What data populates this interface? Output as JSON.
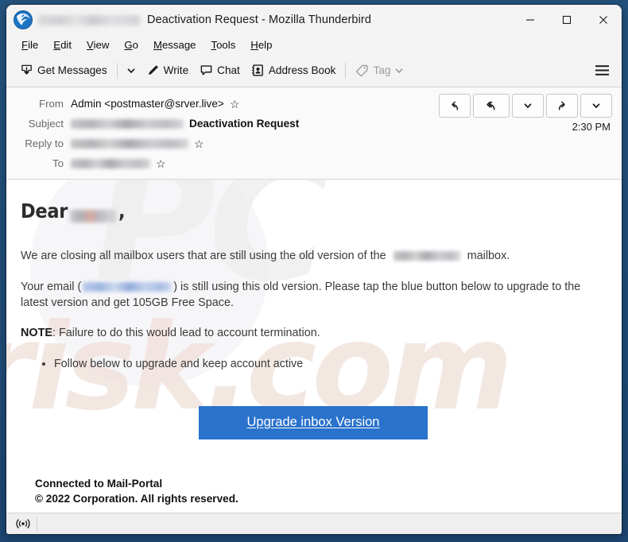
{
  "window": {
    "title": "Deactivation Request - Mozilla Thunderbird",
    "logo_icon": "thunderbird-logo-icon",
    "title_blurred_prefix": "[blurred-email-address]",
    "controls": {
      "minimize": "—",
      "maximize": "☐",
      "close": "✕"
    }
  },
  "menubar": {
    "items": [
      {
        "label": "File",
        "accesskey": "F"
      },
      {
        "label": "Edit",
        "accesskey": "E"
      },
      {
        "label": "View",
        "accesskey": "V"
      },
      {
        "label": "Go",
        "accesskey": "G"
      },
      {
        "label": "Message",
        "accesskey": "M"
      },
      {
        "label": "Tools",
        "accesskey": "T"
      },
      {
        "label": "Help",
        "accesskey": "H"
      }
    ]
  },
  "toolbar": {
    "get_messages_label": "Get Messages",
    "get_messages_icon": "inbox-download-icon",
    "get_messages_dropdown_icon": "chevron-down-icon",
    "write_label": "Write",
    "write_icon": "pencil-icon",
    "chat_label": "Chat",
    "chat_icon": "chat-bubble-icon",
    "address_book_label": "Address Book",
    "address_book_icon": "address-book-icon",
    "tag_label": "Tag",
    "tag_icon": "tag-icon",
    "tag_dropdown_icon": "chevron-down-icon",
    "tag_disabled": true,
    "app_menu_icon": "hamburger-menu-icon"
  },
  "message_header": {
    "from_label": "From",
    "from_value": "Admin <postmaster@srver.live>",
    "from_star_icon": "star-icon",
    "subject_label": "Subject",
    "subject_blurred": "[blurred-sender-address]",
    "subject_value": "Deactivation Request",
    "reply_to_label": "Reply to",
    "reply_to_blurred": "[blurred-reply-to-address]",
    "reply_to_star_icon": "star-icon",
    "to_label": "To",
    "to_blurred": "[blurred-recipient-address]",
    "to_star_icon": "star-icon",
    "timestamp": "2:30 PM",
    "actions": [
      {
        "name": "reply-button",
        "icon": "reply-arrow-icon"
      },
      {
        "name": "reply-all-button",
        "icon": "reply-all-arrow-icon"
      },
      {
        "name": "reply-options-dropdown",
        "icon": "chevron-down-icon"
      },
      {
        "name": "forward-button",
        "icon": "forward-arrow-icon"
      },
      {
        "name": "more-actions-dropdown",
        "icon": "chevron-down-icon"
      }
    ]
  },
  "body": {
    "greeting": "Dear",
    "greeting_blurred_name": "[blurred-recipient-name]",
    "greeting_comma": ",",
    "paragraph1_before": "We are closing all mailbox users that are still using the old version of  the",
    "paragraph1_blurred": "[blurred-domain]",
    "paragraph1_after": "mailbox.",
    "paragraph2_before": "Your email   (",
    "paragraph2_blurred": "[blurred-email-address]",
    "paragraph2_after": ")  is still using this old version. Please tap the blue button below to upgrade to the latest version and get 105GB Free Space.",
    "note_label": "NOTE",
    "note_text": ":  Failure to do this would lead to account termination.",
    "bullets": [
      "Follow  below to upgrade and keep account active"
    ],
    "cta_label": "Upgrade inbox Version ",
    "cta_color": "#2a72cc",
    "footer_line1": "Connected to Mail-Portal",
    "footer_line2": "© 2022  Corporation. All rights reserved.",
    "watermark_top": "PC",
    "watermark_bottom": "risk.com"
  },
  "statusbar": {
    "online_icon": "broadcast-online-icon",
    "status_text": ""
  }
}
